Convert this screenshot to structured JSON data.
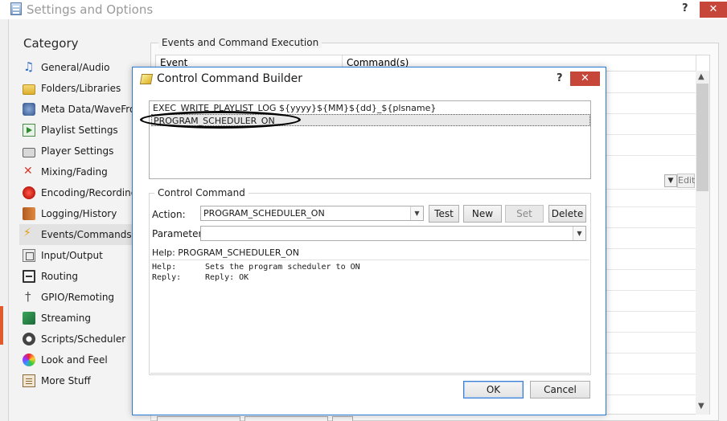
{
  "main_window": {
    "title": "Settings and Options",
    "help": "?",
    "close": "✕"
  },
  "category": {
    "title": "Category",
    "items": [
      {
        "label": "General/Audio",
        "icon": "music-note-icon"
      },
      {
        "label": "Folders/Libraries",
        "icon": "folder-icon"
      },
      {
        "label": "Meta Data/WaveFrom",
        "icon": "meta-data-icon"
      },
      {
        "label": "Playlist Settings",
        "icon": "playlist-icon"
      },
      {
        "label": "Player Settings",
        "icon": "player-icon"
      },
      {
        "label": "Mixing/Fading",
        "icon": "mixing-icon"
      },
      {
        "label": "Encoding/Recording",
        "icon": "record-icon"
      },
      {
        "label": "Logging/History",
        "icon": "logging-icon"
      },
      {
        "label": "Events/Commands",
        "icon": "lightning-icon",
        "selected": true
      },
      {
        "label": "Input/Output",
        "icon": "io-icon"
      },
      {
        "label": "Routing",
        "icon": "routing-icon"
      },
      {
        "label": "GPIO/Remoting",
        "icon": "gpio-icon"
      },
      {
        "label": "Streaming",
        "icon": "streaming-icon"
      },
      {
        "label": "Scripts/Scheduler",
        "icon": "clock-icon"
      },
      {
        "label": "Look and Feel",
        "icon": "palette-icon"
      },
      {
        "label": "More Stuff",
        "icon": "more-icon"
      }
    ]
  },
  "events_panel": {
    "group_title": "Events and Command Execution",
    "col_event": "Event",
    "col_commands": "Command(s)",
    "edit_label": "Edit"
  },
  "dialog": {
    "title": "Control Command Builder",
    "help": "?",
    "close": "✕",
    "commands": [
      "EXEC_WRITE_PLAYLIST_LOG ${yyyy}${MM}${dd}_${plsname}",
      "PROGRAM_SCHEDULER_ON"
    ],
    "control_group_title": "Control Command",
    "action_label": "Action:",
    "action_value": "PROGRAM_SCHEDULER_ON",
    "parameter_label": "Parameter:",
    "parameter_value": "",
    "buttons": {
      "test": "Test",
      "new": "New",
      "set": "Set",
      "delete": "Delete",
      "ok": "OK",
      "cancel": "Cancel"
    },
    "help_title": "Help: PROGRAM_SCHEDULER_ON",
    "help_key": "Help:",
    "help_text": "Sets the program scheduler to ON",
    "reply_key": "Reply:",
    "reply_text": "Reply: OK"
  }
}
